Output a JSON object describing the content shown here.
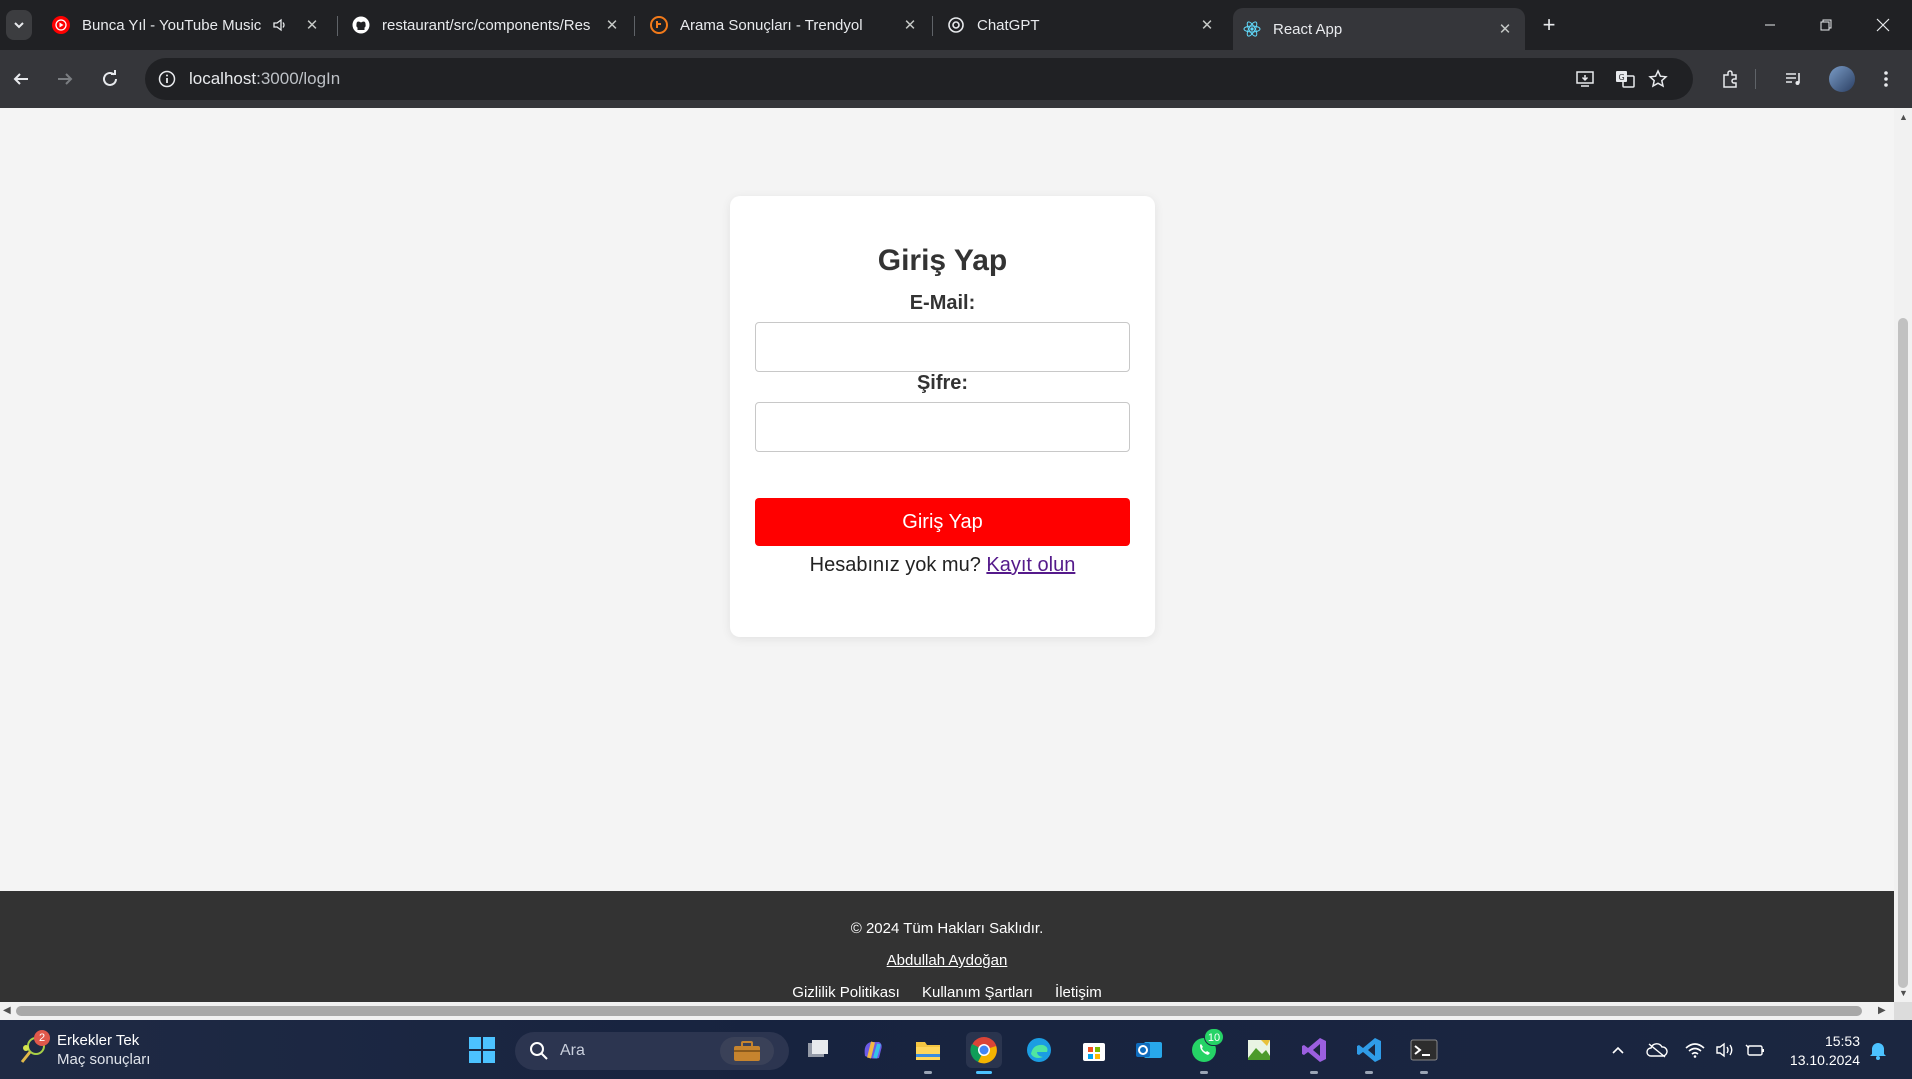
{
  "browser": {
    "tabs": [
      {
        "title": "Bunca Yıl - YouTube Music",
        "icon": "youtube-music-icon",
        "audio": true
      },
      {
        "title": "restaurant/src/components/Res",
        "icon": "github-icon"
      },
      {
        "title": "Arama Sonuçları - Trendyol",
        "icon": "trendyol-icon"
      },
      {
        "title": "ChatGPT",
        "icon": "chatgpt-icon"
      },
      {
        "title": "React App",
        "icon": "react-icon",
        "active": true
      }
    ],
    "address": {
      "host": "localhost",
      "path": ":3000/logIn"
    }
  },
  "login": {
    "heading": "Giriş Yap",
    "email_label": "E-Mail:",
    "email_value": "",
    "password_label": "Şifre:",
    "password_value": "",
    "submit_label": "Giriş Yap",
    "signup_prompt": "Hesabınız yok mu?",
    "signup_link": "Kayıt olun"
  },
  "footer": {
    "copyright": "© 2024 Tüm Hakları Saklıdır.",
    "author": "Abdullah Aydoğan",
    "links": [
      "Gizlilik Politikası",
      "Kullanım Şartları",
      "İletişim"
    ]
  },
  "taskbar": {
    "weather_badge": "2",
    "weather_title": "Erkekler Tek",
    "weather_subtitle": "Maç sonuçları",
    "search_placeholder": "Ara",
    "whatsapp_badge": "10",
    "time": "15:53",
    "date": "13.10.2024"
  },
  "colors": {
    "primary_button": "#ff0000",
    "footer_bg": "#333333",
    "page_bg": "#f4f4f4"
  }
}
